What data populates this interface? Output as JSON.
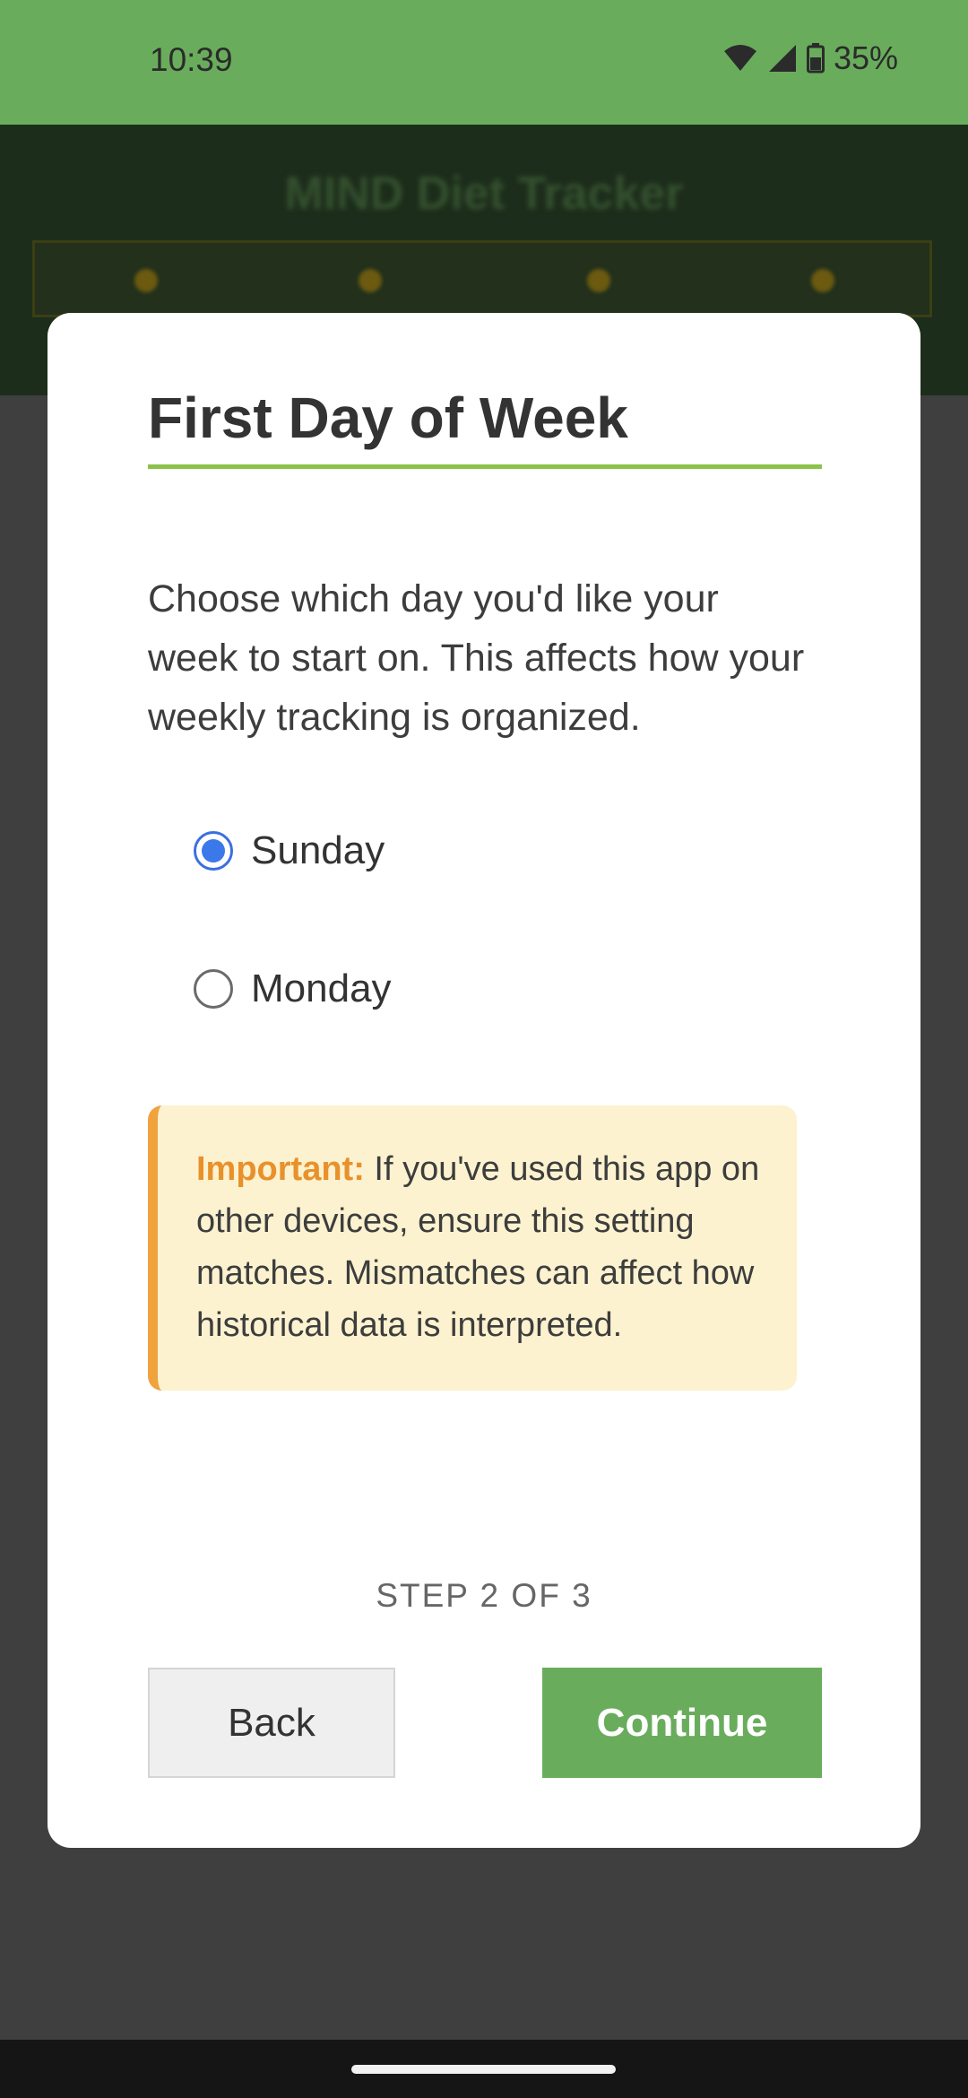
{
  "status_bar": {
    "time": "10:39",
    "battery": "35%",
    "icons": [
      "wifi-icon",
      "signal-icon",
      "battery-icon"
    ]
  },
  "background_app": {
    "title": "MIND Diet Tracker"
  },
  "dialog": {
    "title": "First Day of Week",
    "description": "Choose which day you'd like your week to start on. This affects how your weekly tracking is organized.",
    "options": [
      {
        "label": "Sunday",
        "selected": true
      },
      {
        "label": "Monday",
        "selected": false
      }
    ],
    "notice": {
      "label": "Important:",
      "text": " If you've used this app on other devices, ensure this setting matches. Mismatches can affect how historical data is interpreted."
    },
    "step": "STEP 2 OF 3",
    "back_label": "Back",
    "continue_label": "Continue"
  },
  "colors": {
    "accent_green": "#69ad5c",
    "underline_green": "#8bc34a",
    "radio_blue": "#3b78ea",
    "notice_orange": "#f0a23c",
    "notice_bg": "#fcf2cf"
  }
}
